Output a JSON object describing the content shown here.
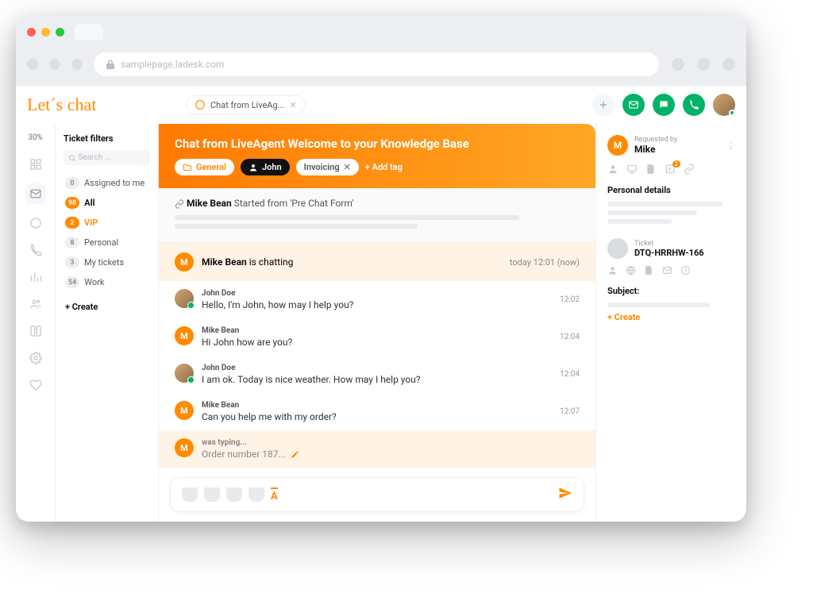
{
  "url": "samplepage.ladesk.com",
  "logo": "Let´s chat",
  "rail_percent": "30%",
  "tab_title": "Chat from LiveAg...",
  "filters": {
    "title": "Ticket filters",
    "search_placeholder": "Search ...",
    "items": [
      {
        "count": "0",
        "label": "Assigned to me"
      },
      {
        "count": "98",
        "label": "All"
      },
      {
        "count": "2",
        "label": "VIP"
      },
      {
        "count": "8",
        "label": "Personal"
      },
      {
        "count": "3",
        "label": "My tickets"
      },
      {
        "count": "54",
        "label": "Work"
      }
    ],
    "create": "+ Create"
  },
  "hero": {
    "title": "Chat from LiveAgent Welcome to your Knowledge Base",
    "tag_general": "General",
    "tag_john": "John",
    "tag_invoicing": "Invoicing",
    "add_tag": "+  Add tag"
  },
  "started": {
    "name": "Mike Bean",
    "text": "Started from 'Pre Chat Form'"
  },
  "status": {
    "avatar": "M",
    "name": "Mike Bean",
    "verb": "is chatting",
    "time": "today 12:01 (now)"
  },
  "messages": [
    {
      "who": "j",
      "name": "John Doe",
      "text": "Hello, I'm John, how may I help you?",
      "time": "12:02"
    },
    {
      "who": "m",
      "name": "Mike Bean",
      "text": "Hi John how are you?",
      "time": "12:04"
    },
    {
      "who": "j",
      "name": "John Doe",
      "text": "I am ok. Today is nice weather. How may I help you?",
      "time": "12:04"
    },
    {
      "who": "m",
      "name": "Mike Bean",
      "text": "Can you help me with my order?",
      "time": "12:07"
    }
  ],
  "typing": {
    "avatar": "M",
    "label": "was typing...",
    "text": "Order number 187..."
  },
  "format_label": "A",
  "side": {
    "requested_by_label": "Requested by",
    "requester_name": "Mike",
    "requester_avatar": "M",
    "note_badge": "2",
    "personal_details": "Personal details",
    "ticket_label": "Ticket",
    "ticket_id": "DTQ-HRRHW-166",
    "subject_label": "Subject:",
    "create": "+  Create"
  }
}
